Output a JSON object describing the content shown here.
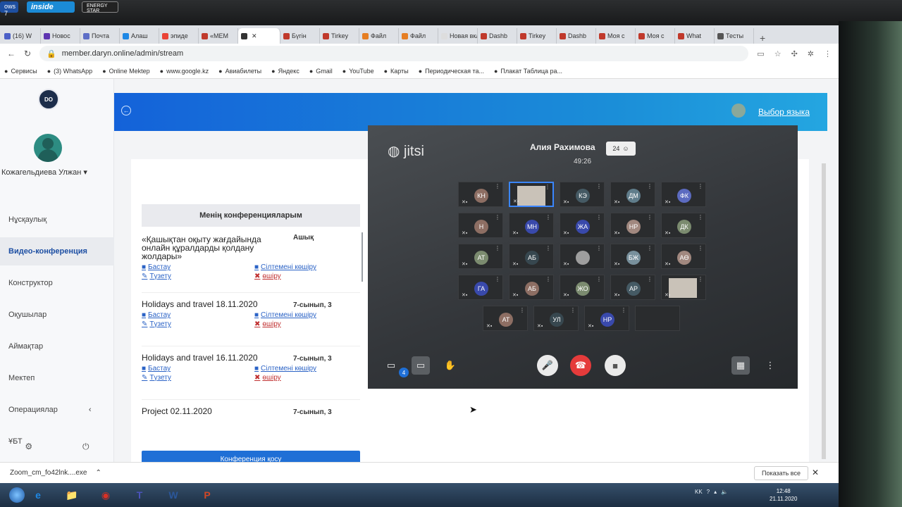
{
  "stickers": {
    "a": "ows 7",
    "b": "inside",
    "c": "ENERGY STAR"
  },
  "tabs": [
    {
      "label": "(16) W",
      "color": "#4b5fc7"
    },
    {
      "label": "Новос",
      "color": "#5e35b1"
    },
    {
      "label": "Почта",
      "color": "#5d6ec7"
    },
    {
      "label": "Алаш",
      "color": "#1e88e5"
    },
    {
      "label": "эпиде",
      "color": "#ea4335"
    },
    {
      "label": "«МЕМ",
      "color": "#c0392b"
    },
    {
      "label": "",
      "color": "#333333"
    },
    {
      "label": "Бүгін",
      "color": "#c0392b"
    },
    {
      "label": "Tirkey",
      "color": "#c0392b"
    },
    {
      "label": "Файл",
      "color": "#e67e22"
    },
    {
      "label": "Файл",
      "color": "#e67e22"
    },
    {
      "label": "Новая вкл",
      "color": "#dddddd"
    },
    {
      "label": "Dashb",
      "color": "#c0392b"
    },
    {
      "label": "Tirkey",
      "color": "#c0392b"
    },
    {
      "label": "Dashb",
      "color": "#c0392b"
    },
    {
      "label": "Моя с",
      "color": "#c0392b"
    },
    {
      "label": "Моя с",
      "color": "#c0392b"
    },
    {
      "label": "What",
      "color": "#c0392b"
    },
    {
      "label": "Тесты",
      "color": "#555555"
    }
  ],
  "address": {
    "url": "member.daryn.online/admin/stream"
  },
  "bookmarks": [
    "Сервисы",
    "(3) WhatsApp",
    "Online Mektep",
    "www.google.kz",
    "Авиабилеты",
    "Яндекс",
    "Gmail",
    "YouTube",
    "Карты",
    "Периодическая та...",
    "Плакат Таблица ра..."
  ],
  "sidebar": {
    "logo": "DO",
    "user_name": "Кожагельдиева Улжан",
    "items": [
      "Нұсқаулық",
      "Видео-конференция",
      "Конструктор",
      "Оқушылар",
      "Аймақтар",
      "Мектеп",
      "Операциялар",
      "ҰБТ"
    ]
  },
  "topbar": {
    "language": "Выбор языка"
  },
  "page_title": "Видео-конференция",
  "conferences": {
    "heading": "Менің конференцияларым",
    "items": [
      {
        "title": "«Қашықтан оқыту жағдайында онлайн құралдарды қолдану жолдары»",
        "grade": "Ашық"
      },
      {
        "title": "Holidays and travel 18.11.2020",
        "grade": "7-сынып, 3"
      },
      {
        "title": "Holidays and travel 16.11.2020",
        "grade": "7-сынып, 3"
      },
      {
        "title": "Project 02.11.2020",
        "grade": "7-сынып, 3"
      }
    ],
    "actions": {
      "start": "Бастау",
      "copy": "Сілтемені көшіру",
      "edit": "Түзету",
      "delete": "өшіру"
    },
    "add_button": "Конференция қосу"
  },
  "jitsi": {
    "logo": "jitsi",
    "caller": "Алия Рахимова",
    "timer": "49:26",
    "participants": "24",
    "chat_unread": "4",
    "tiles": [
      {
        "ini": "КН",
        "color": "#8d6e63"
      },
      {
        "ini": "",
        "color": "",
        "photo": true,
        "speaking": true
      },
      {
        "ini": "КЭ",
        "color": "#455a64"
      },
      {
        "ini": "ДМ",
        "color": "#607d8b"
      },
      {
        "ini": "ФК",
        "color": "#5c6bc0"
      },
      {
        "ini": "Н",
        "color": "#8d6e63"
      },
      {
        "ini": "МН",
        "color": "#3949ab"
      },
      {
        "ini": "ЖА",
        "color": "#3949ab"
      },
      {
        "ini": "НР",
        "color": "#a1887f"
      },
      {
        "ini": "ДК",
        "color": "#7b8b6f"
      },
      {
        "ini": "АТ",
        "color": "#7b8b6f"
      },
      {
        "ini": "АБ",
        "color": "#37474f"
      },
      {
        "ini": "",
        "color": "#9e9e9e"
      },
      {
        "ini": "БЖ",
        "color": "#78909c"
      },
      {
        "ini": "АӨ",
        "color": "#a1887f"
      },
      {
        "ini": "ГА",
        "color": "#3949ab"
      },
      {
        "ini": "АБ",
        "color": "#8d6e63"
      },
      {
        "ini": "ЖО",
        "color": "#7b8b6f"
      },
      {
        "ini": "АР",
        "color": "#455a64"
      },
      {
        "ini": "",
        "color": "",
        "photo": true
      },
      {
        "ini": "АТ",
        "color": "#8d6e63"
      },
      {
        "ini": "УЛ",
        "color": "#37474f"
      },
      {
        "ini": "НР",
        "color": "#3949ab"
      },
      {
        "ini": "",
        "color": ""
      }
    ]
  },
  "downloads": {
    "file": "Zoom_cm_fo42lnk....exe",
    "show_all": "Показать все"
  },
  "taskbar": {
    "lang": "KK",
    "time": "12:48",
    "date": "21.11.2020",
    "apps": [
      "e",
      "📁",
      "◉",
      "T",
      "W",
      "P"
    ]
  }
}
